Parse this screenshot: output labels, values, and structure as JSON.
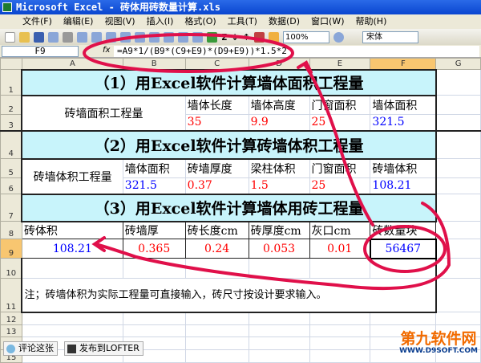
{
  "window": {
    "title": "Microsoft Excel - 砖体用砖数量计算.xls"
  },
  "menu": [
    "文件(F)",
    "编辑(E)",
    "视图(V)",
    "插入(I)",
    "格式(O)",
    "工具(T)",
    "数据(D)",
    "窗口(W)",
    "帮助(H)"
  ],
  "toolbar": {
    "zoom": "100%",
    "font": "宋体"
  },
  "formula_bar": {
    "name_box": "F9",
    "fx": "fx",
    "formula": "=A9*1/(B9*(C9+E9)*(D9+E9))*1.5*2"
  },
  "columns": [
    "A",
    "B",
    "C",
    "D",
    "E",
    "F",
    "G"
  ],
  "rows": [
    "1",
    "2",
    "3",
    "4",
    "5",
    "6",
    "7",
    "8",
    "9",
    "10",
    "11",
    "12",
    "13",
    "14",
    "15"
  ],
  "sheet": {
    "s1_title": "（1）用Excel软件计算墙体面积工程量",
    "s1_label": "砖墙面积工程量",
    "s1_headers": [
      "墙体长度",
      "墙体高度",
      "门窗面积",
      "墙体面积"
    ],
    "s1_values": [
      "35",
      "9.9",
      "25",
      "321.5"
    ],
    "s2_title": "（2）用Excel软件计算砖墙体积工程量",
    "s2_label": "砖墙体积工程量",
    "s2_headers": [
      "墙体面积",
      "砖墙厚度",
      "梁柱体积",
      "门窗面积",
      "砖墙体积"
    ],
    "s2_values": [
      "321.5",
      "0.37",
      "1.5",
      "25",
      "108.21"
    ],
    "s3_title": "（3）用Excel软件计算墙体用砖工程量",
    "s3_headers": [
      "砖体积",
      "砖墙厚",
      "砖长度cm",
      "砖厚度cm",
      "灰口cm",
      "砖数量块"
    ],
    "s3_values": [
      "108.21",
      "0.365",
      "0.24",
      "0.053",
      "0.01",
      "56467"
    ],
    "note": "注；砖墙体积为实际工程量可直接输入，砖尺寸按设计要求输入。"
  },
  "bottom": {
    "comment": "评论这张",
    "publish": "发布到LOFTER"
  },
  "watermark": {
    "name": "第九软件网",
    "url": "WWW.D9SOFT.COM"
  },
  "colors": {
    "section_bg": "#c8f4fb",
    "annotation": "#e0104a",
    "input": "#ff0000",
    "result": "#0000ff"
  }
}
